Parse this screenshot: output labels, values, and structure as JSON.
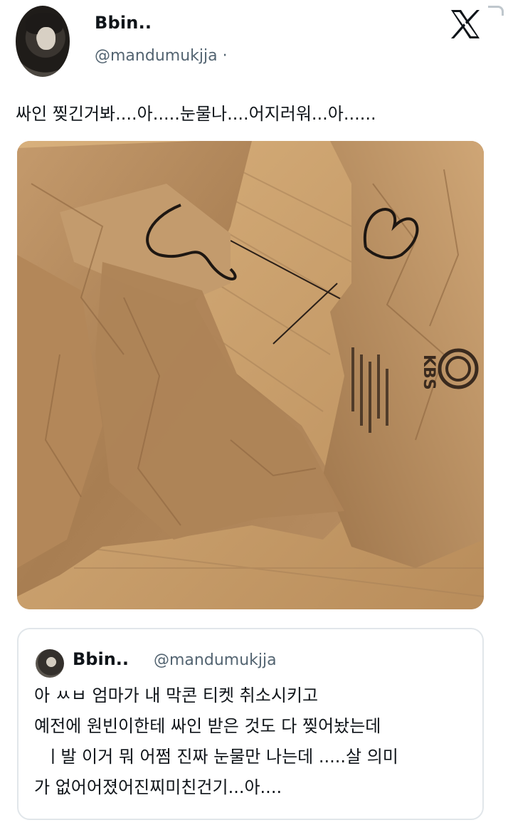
{
  "author": {
    "display_name": "Bbin..",
    "handle": "@mandumukjja",
    "separator": "·"
  },
  "tweet": {
    "text": "싸인 찢긴거봐....아.....눈물나....어지러워...아......"
  },
  "icons": {
    "platform": "x-logo-icon"
  },
  "photo": {
    "package_label": "KBS",
    "colors": {
      "paper": "#b38a5e",
      "floor": "#c89c6a",
      "ink": "#2a1f18"
    }
  },
  "quoted_tweet": {
    "display_name": "Bbin..",
    "handle": "@mandumukjja",
    "lines": [
      "아 ㅆㅂ 엄마가 내 막콘 티켓 취소시키고",
      "예전에 원빈이한테 싸인 받은 것도 다 찢어놨는데",
      "  ㅣ발 이거 뭐 어쩜 진짜 눈물만 나는데 .....살 의미",
      "가 없어어졌어진찌미친건기...아...."
    ]
  }
}
